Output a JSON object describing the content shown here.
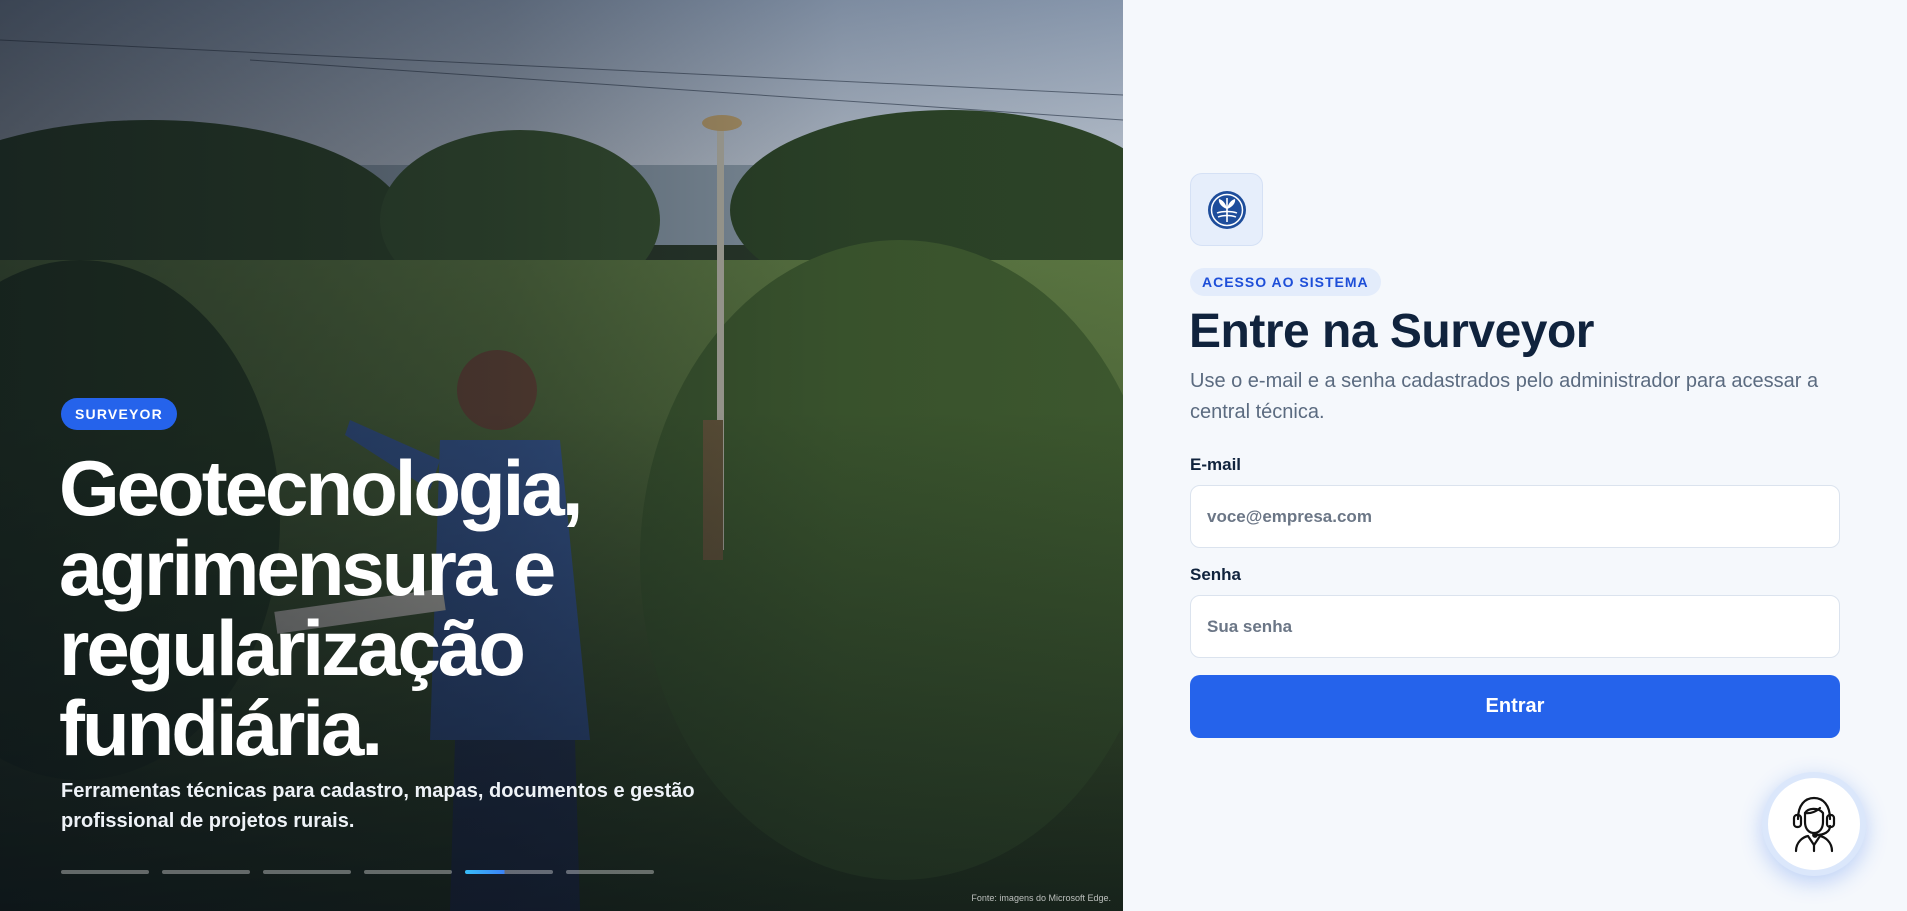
{
  "hero": {
    "badge": "SURVEYOR",
    "title_lines": [
      "Geotecnologia,",
      "agrimensura e",
      "regularização",
      "fundiária."
    ],
    "subtitle": "Ferramentas técnicas para cadastro, mapas, documentos e gestão profissional de projetos rurais.",
    "slide_count": 6,
    "active_slide": 5,
    "image_credit": "Fonte: imagens do Microsoft Edge."
  },
  "login": {
    "eyebrow": "ACESSO AO SISTEMA",
    "title": "Entre na Surveyor",
    "description": "Use o e-mail e a senha cadastrados pelo administrador para acessar a central técnica.",
    "email": {
      "label": "E-mail",
      "placeholder": "voce@empresa.com",
      "value": ""
    },
    "password": {
      "label": "Senha",
      "placeholder": "Sua senha",
      "value": ""
    },
    "submit_label": "Entrar"
  },
  "icons": {
    "logo": "surveyor-logo-icon",
    "support": "support-agent-icon"
  },
  "colors": {
    "accent": "#2563eb",
    "title_text": "#10233d",
    "panel_background": "#f5f8fc"
  }
}
